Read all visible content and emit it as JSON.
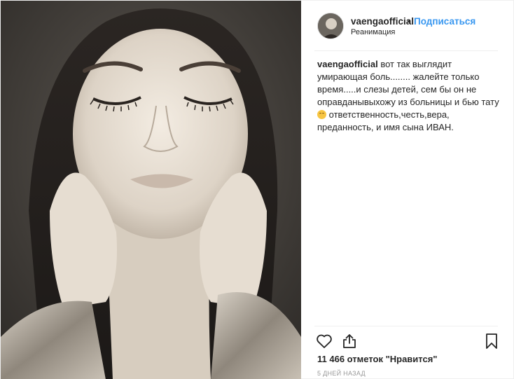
{
  "post": {
    "username": "vaengaofficial",
    "separator": "•",
    "follow_label": "Подписаться",
    "location": "Реанимация",
    "caption_user": "vaengaofficial",
    "caption_text_1": "вот так выглядит умирающая боль........ жалейте только время.....и слезы детей, сем бы он не оправданывыхожу из больницы и бью тату",
    "caption_text_2": "ответственность,честь,вера, преданность, и имя сына ИВАН.",
    "likes": "11 466 отметок \"Нравится\"",
    "date": "5 ДНЕЙ НАЗАД"
  },
  "icons": {
    "like": "heart-icon",
    "share": "share-icon",
    "save": "bookmark-icon",
    "caption_emoji": "smiling-face-emoji"
  },
  "colors": {
    "link": "#3897f0",
    "text": "#262626",
    "muted": "#999999"
  }
}
